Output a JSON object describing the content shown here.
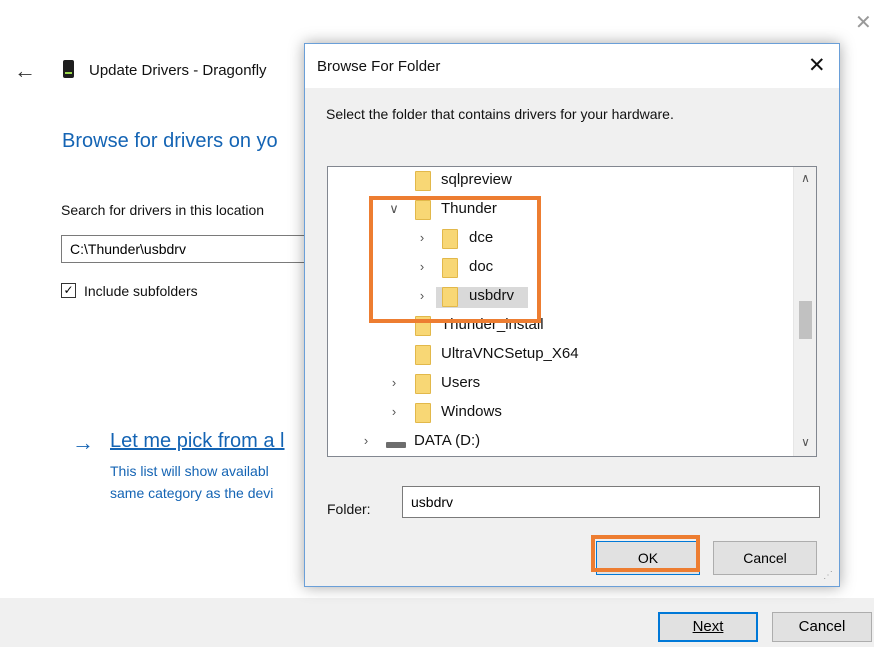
{
  "wizard": {
    "title": "Update Drivers - Dragonfly",
    "heading": "Browse for drivers on yo",
    "search_label": "Search for drivers in this location",
    "path_value": "C:\\Thunder\\usbdrv",
    "include_subfolders": "Include subfolders",
    "include_checked": "✓",
    "pick_link": "Let me pick from a l",
    "pick_desc_line1": "This list will show availabl",
    "pick_desc_line2": "same category as the devi",
    "next_label": "Next",
    "cancel_label": "Cancel"
  },
  "dialog": {
    "title": "Browse For Folder",
    "instruction": "Select the folder that contains drivers for your hardware.",
    "tree": [
      {
        "label": "sqlpreview",
        "expander": "",
        "icon": "folder-icon"
      },
      {
        "label": "Thunder",
        "expander": "expanded",
        "icon": "folder-icon"
      },
      {
        "label": "dce",
        "expander": "collapsed",
        "icon": "folder-icon"
      },
      {
        "label": "doc",
        "expander": "collapsed",
        "icon": "folder-icon"
      },
      {
        "label": "usbdrv",
        "expander": "collapsed",
        "icon": "folder-icon",
        "selected": true
      },
      {
        "label": "Thunder_install",
        "expander": "",
        "icon": "folder-icon"
      },
      {
        "label": "UltraVNCSetup_X64",
        "expander": "",
        "icon": "folder-icon"
      },
      {
        "label": "Users",
        "expander": "collapsed",
        "icon": "folder-icon"
      },
      {
        "label": "Windows",
        "expander": "collapsed",
        "icon": "folder-icon"
      },
      {
        "label": "DATA (D:)",
        "expander": "collapsed",
        "icon": "drive-icon"
      }
    ],
    "folder_label": "Folder:",
    "folder_value": "usbdrv",
    "ok_label": "OK",
    "cancel_label": "Cancel"
  },
  "colors": {
    "highlight": "#ed7d31",
    "link": "#1464b4",
    "focus": "#0078d7"
  }
}
